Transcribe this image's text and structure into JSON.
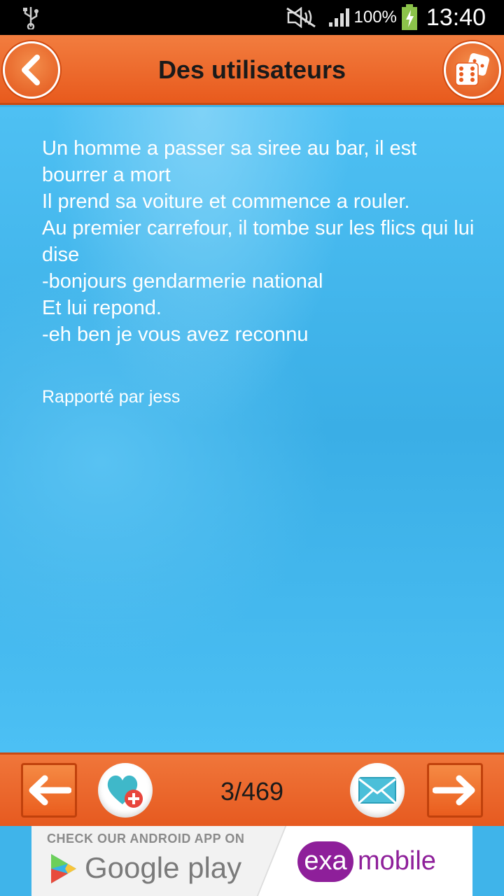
{
  "status_bar": {
    "battery_percent": "100%",
    "time": "13:40"
  },
  "header": {
    "title": "Des utilisateurs"
  },
  "joke": {
    "lines": [
      "Un homme a passer sa siree au bar, il est bourrer a mort",
      "Il prend sa voiture et commence a rouler.",
      "Au premier carrefour, il tombe sur les flics qui lui dise",
      "-bonjours gendarmerie national",
      "Et lui repond.",
      "-eh ben je vous avez reconnu"
    ],
    "reported_by": "Rapporté par jess"
  },
  "bottom_bar": {
    "counter": "3/469"
  },
  "ad": {
    "check_text": "CHECK OUR ANDROID APP ON",
    "store_text": "Google play",
    "brand_badge": "exa",
    "brand_text": "mobile"
  },
  "colors": {
    "header_orange": "#e85a1d",
    "content_blue": "#3fb4ea",
    "brand_purple": "#8e1f9a"
  },
  "icons": [
    "usb-icon",
    "mute-icon",
    "signal-icon",
    "battery-icon",
    "back-chevron-icon",
    "dice-icon",
    "arrow-left-icon",
    "heart-plus-icon",
    "mail-icon",
    "arrow-right-icon",
    "google-play-icon"
  ]
}
